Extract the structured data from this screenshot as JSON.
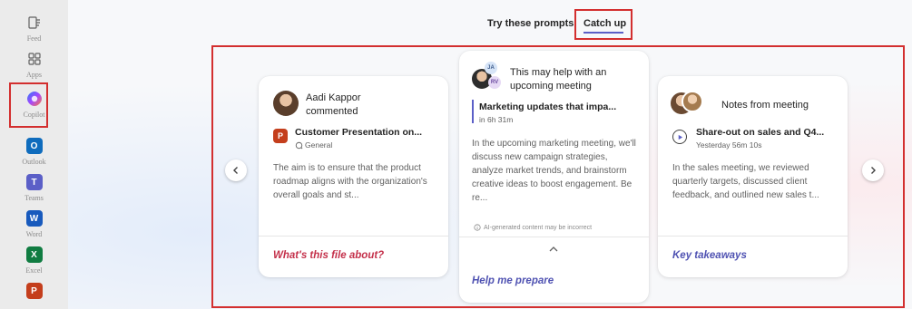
{
  "rail": {
    "items": [
      {
        "label": "Feed"
      },
      {
        "label": "Apps"
      },
      {
        "label": "Copilot"
      },
      {
        "label": "Outlook"
      },
      {
        "label": "Teams"
      },
      {
        "label": "Word"
      },
      {
        "label": "Excel"
      }
    ]
  },
  "tabs": [
    {
      "label": "Try these prompts",
      "selected": false
    },
    {
      "label": "Catch up",
      "selected": true
    }
  ],
  "cards": [
    {
      "person": "Aadi Kappor",
      "action": "commented",
      "item_title": "Customer Presentation on...",
      "item_sub": "General",
      "body": "The aim is to ensure that the product roadmap aligns with the organization's overall goals and st...",
      "link": "What's this file about?"
    },
    {
      "avatar_initials": [
        "JA",
        "RV"
      ],
      "header_line1": "This may help with an",
      "header_line2": "upcoming meeting",
      "item_title": "Marketing updates that impa...",
      "item_sub": "in 6h 31m",
      "body": "In the upcoming marketing meeting, we'll discuss new campaign strategies, analyze market trends, and brainstorm creative ideas to boost engagement. Be re...",
      "disclaimer": "AI-generated content may be incorrect",
      "link": "Help me prepare"
    },
    {
      "header": "Notes from meeting",
      "item_title": "Share-out on sales and Q4...",
      "item_sub": "Yesterday 56m 10s",
      "body": "In the sales meeting, we reviewed quarterly targets, discussed client feedback, and outlined new sales t...",
      "link": "Key takeaways"
    }
  ],
  "colors": {
    "accent": "#5b5fc7",
    "highlight": "#d32f2f",
    "link_red": "#c4314b",
    "link_blue": "#4f52b2"
  }
}
